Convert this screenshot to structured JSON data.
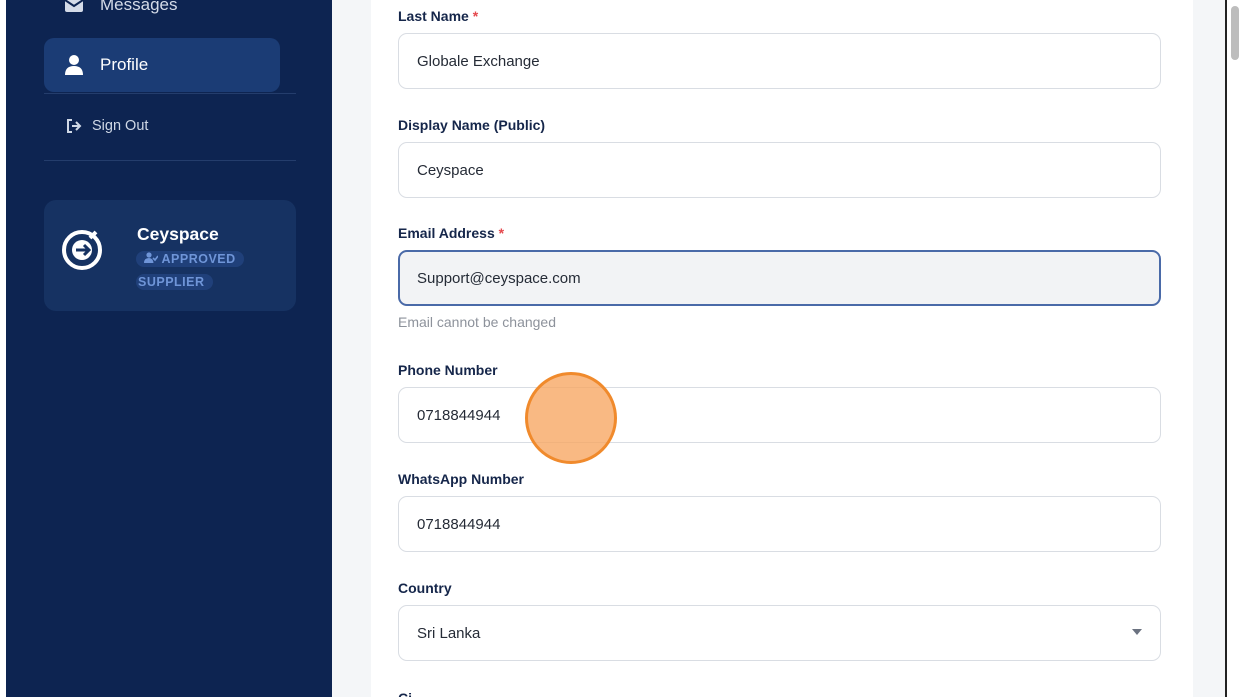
{
  "sidebar": {
    "items": [
      {
        "label": "Messages",
        "icon": "envelope-icon"
      },
      {
        "label": "Profile",
        "icon": "user-icon",
        "active": true
      }
    ],
    "sign_out": {
      "label": "Sign Out",
      "icon": "sign-out-icon"
    },
    "supplier": {
      "name": "Ceyspace",
      "badge_line1": "APPROVED",
      "badge_line2": "SUPPLIER",
      "badge_icon": "user-check-icon"
    }
  },
  "form": {
    "fields": [
      {
        "label": "Last Name",
        "required": true,
        "value": "Globale Exchange"
      },
      {
        "label": "Display Name (Public)",
        "required": false,
        "value": "Ceyspace"
      },
      {
        "label": "Email Address",
        "required": true,
        "value": "Support@ceyspace.com",
        "helper": "Email cannot be changed",
        "disabled": true
      },
      {
        "label": "Phone Number",
        "required": false,
        "value": "0718844944"
      },
      {
        "label": "WhatsApp Number",
        "required": false,
        "value": "0718844944"
      },
      {
        "label": "Country",
        "required": false,
        "value": "Sri Lanka",
        "type": "select"
      }
    ],
    "next_label_partial": "Ci"
  },
  "required_marker": "*",
  "colors": {
    "sidebar_bg": "#0d2451",
    "active_item_bg": "#1b3c75",
    "required": "#e5484d",
    "cursor_highlight": "#f08a2c"
  }
}
